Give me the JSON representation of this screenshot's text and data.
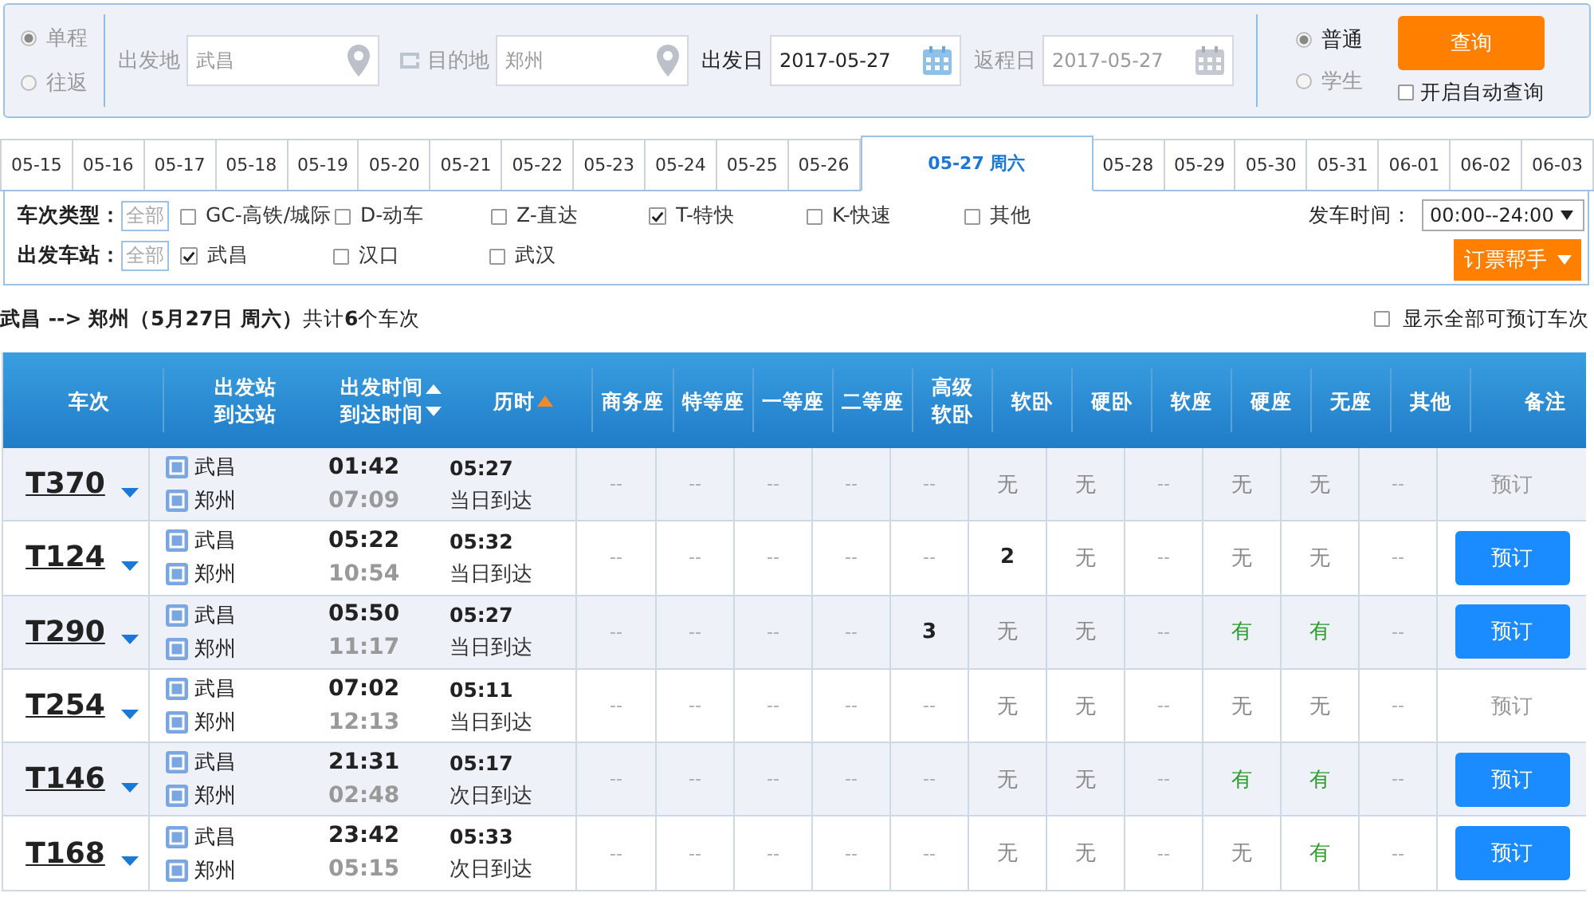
{
  "search": {
    "trip_types": [
      {
        "label": "单程",
        "selected": true
      },
      {
        "label": "往返",
        "selected": false
      }
    ],
    "fields": [
      {
        "label": "出发地",
        "value": "武昌",
        "kind": "place",
        "active": false
      },
      {
        "label": "目的地",
        "value": "郑州",
        "kind": "place",
        "active": false
      },
      {
        "label": "出发日",
        "value": "2017-05-27",
        "kind": "date",
        "active": true
      },
      {
        "label": "返程日",
        "value": "2017-05-27",
        "kind": "date",
        "active": false
      }
    ],
    "passenger_types": [
      {
        "label": "普通",
        "selected": true
      },
      {
        "label": "学生",
        "selected": false
      }
    ],
    "query_button": "查询",
    "auto_query": {
      "label": "开启自动查询",
      "checked": false
    }
  },
  "date_tabs": [
    {
      "label": "05-15",
      "selected": false
    },
    {
      "label": "05-16",
      "selected": false
    },
    {
      "label": "05-17",
      "selected": false
    },
    {
      "label": "05-18",
      "selected": false
    },
    {
      "label": "05-19",
      "selected": false
    },
    {
      "label": "05-20",
      "selected": false
    },
    {
      "label": "05-21",
      "selected": false
    },
    {
      "label": "05-22",
      "selected": false
    },
    {
      "label": "05-23",
      "selected": false
    },
    {
      "label": "05-24",
      "selected": false
    },
    {
      "label": "05-25",
      "selected": false
    },
    {
      "label": "05-26",
      "selected": false
    },
    {
      "label": "05-27 周六",
      "selected": true
    },
    {
      "label": "05-28",
      "selected": false
    },
    {
      "label": "05-29",
      "selected": false
    },
    {
      "label": "05-30",
      "selected": false
    },
    {
      "label": "05-31",
      "selected": false
    },
    {
      "label": "06-01",
      "selected": false
    },
    {
      "label": "06-02",
      "selected": false
    },
    {
      "label": "06-03",
      "selected": false
    }
  ],
  "filters": [
    {
      "label": "车次类型：",
      "all_button": "全部",
      "options": [
        {
          "label": "GC-高铁/城际",
          "checked": false
        },
        {
          "label": "D-动车",
          "checked": false
        },
        {
          "label": "Z-直达",
          "checked": false
        },
        {
          "label": "T-特快",
          "checked": true
        },
        {
          "label": "K-快速",
          "checked": false
        },
        {
          "label": "其他",
          "checked": false
        }
      ]
    },
    {
      "label": "出发车站：",
      "all_button": "全部",
      "options": [
        {
          "label": "武昌",
          "checked": true
        },
        {
          "label": "汉口",
          "checked": false
        },
        {
          "label": "武汉",
          "checked": false
        }
      ]
    }
  ],
  "departure_time": {
    "label": "发车时间：",
    "value": "00:00--24:00"
  },
  "helper_button": "订票帮手",
  "summary": "**武昌 --> 郑州（5月27日  周六）**共计**6**个车次",
  "show_all": {
    "label": "显示全部可预订车次",
    "checked": false
  },
  "table": {
    "columns": [
      "车次",
      "出发站到达站",
      "出发时间到达时间",
      "历时",
      "商务座",
      "特等座",
      "一等座",
      "二等座",
      "高级软卧",
      "软卧",
      "硬卧",
      "软座",
      "硬座",
      "无座",
      "其他",
      "备注"
    ],
    "rows": [
      {
        "train": "T370",
        "from": "武昌",
        "to": "郑州",
        "depart": "01:42",
        "arrive": "07:09",
        "duration": "05:27",
        "arrival_day": "当日到达",
        "seats": [
          {
            "text": "--",
            "kind": "na"
          },
          {
            "text": "--",
            "kind": "na"
          },
          {
            "text": "--",
            "kind": "na"
          },
          {
            "text": "--",
            "kind": "na"
          },
          {
            "text": "--",
            "kind": "na"
          },
          {
            "text": "无",
            "kind": "none"
          },
          {
            "text": "无",
            "kind": "none"
          },
          {
            "text": "--",
            "kind": "na"
          },
          {
            "text": "无",
            "kind": "none"
          },
          {
            "text": "无",
            "kind": "none"
          },
          {
            "text": "--",
            "kind": "na"
          }
        ],
        "book": {
          "label": "预订",
          "enabled": false
        }
      },
      {
        "train": "T124",
        "from": "武昌",
        "to": "郑州",
        "depart": "05:22",
        "arrive": "10:54",
        "duration": "05:32",
        "arrival_day": "当日到达",
        "seats": [
          {
            "text": "--",
            "kind": "na"
          },
          {
            "text": "--",
            "kind": "na"
          },
          {
            "text": "--",
            "kind": "na"
          },
          {
            "text": "--",
            "kind": "na"
          },
          {
            "text": "--",
            "kind": "na"
          },
          {
            "text": "2",
            "kind": "count"
          },
          {
            "text": "无",
            "kind": "none"
          },
          {
            "text": "--",
            "kind": "na"
          },
          {
            "text": "无",
            "kind": "none"
          },
          {
            "text": "无",
            "kind": "none"
          },
          {
            "text": "--",
            "kind": "na"
          }
        ],
        "book": {
          "label": "预订",
          "enabled": true
        }
      },
      {
        "train": "T290",
        "from": "武昌",
        "to": "郑州",
        "depart": "05:50",
        "arrive": "11:17",
        "duration": "05:27",
        "arrival_day": "当日到达",
        "seats": [
          {
            "text": "--",
            "kind": "na"
          },
          {
            "text": "--",
            "kind": "na"
          },
          {
            "text": "--",
            "kind": "na"
          },
          {
            "text": "--",
            "kind": "na"
          },
          {
            "text": "3",
            "kind": "count"
          },
          {
            "text": "无",
            "kind": "none"
          },
          {
            "text": "无",
            "kind": "none"
          },
          {
            "text": "--",
            "kind": "na"
          },
          {
            "text": "有",
            "kind": "available"
          },
          {
            "text": "有",
            "kind": "available"
          },
          {
            "text": "--",
            "kind": "na"
          }
        ],
        "book": {
          "label": "预订",
          "enabled": true
        }
      },
      {
        "train": "T254",
        "from": "武昌",
        "to": "郑州",
        "depart": "07:02",
        "arrive": "12:13",
        "duration": "05:11",
        "arrival_day": "当日到达",
        "seats": [
          {
            "text": "--",
            "kind": "na"
          },
          {
            "text": "--",
            "kind": "na"
          },
          {
            "text": "--",
            "kind": "na"
          },
          {
            "text": "--",
            "kind": "na"
          },
          {
            "text": "--",
            "kind": "na"
          },
          {
            "text": "无",
            "kind": "none"
          },
          {
            "text": "无",
            "kind": "none"
          },
          {
            "text": "--",
            "kind": "na"
          },
          {
            "text": "无",
            "kind": "none"
          },
          {
            "text": "无",
            "kind": "none"
          },
          {
            "text": "--",
            "kind": "na"
          }
        ],
        "book": {
          "label": "预订",
          "enabled": false
        }
      },
      {
        "train": "T146",
        "from": "武昌",
        "to": "郑州",
        "depart": "21:31",
        "arrive": "02:48",
        "duration": "05:17",
        "arrival_day": "次日到达",
        "seats": [
          {
            "text": "--",
            "kind": "na"
          },
          {
            "text": "--",
            "kind": "na"
          },
          {
            "text": "--",
            "kind": "na"
          },
          {
            "text": "--",
            "kind": "na"
          },
          {
            "text": "--",
            "kind": "na"
          },
          {
            "text": "无",
            "kind": "none"
          },
          {
            "text": "无",
            "kind": "none"
          },
          {
            "text": "--",
            "kind": "na"
          },
          {
            "text": "有",
            "kind": "available"
          },
          {
            "text": "有",
            "kind": "available"
          },
          {
            "text": "--",
            "kind": "na"
          }
        ],
        "book": {
          "label": "预订",
          "enabled": true
        }
      },
      {
        "train": "T168",
        "from": "武昌",
        "to": "郑州",
        "depart": "23:42",
        "arrive": "05:15",
        "duration": "05:33",
        "arrival_day": "次日到达",
        "seats": [
          {
            "text": "--",
            "kind": "na"
          },
          {
            "text": "--",
            "kind": "na"
          },
          {
            "text": "--",
            "kind": "na"
          },
          {
            "text": "--",
            "kind": "na"
          },
          {
            "text": "--",
            "kind": "na"
          },
          {
            "text": "无",
            "kind": "none"
          },
          {
            "text": "无",
            "kind": "none"
          },
          {
            "text": "--",
            "kind": "na"
          },
          {
            "text": "无",
            "kind": "none"
          },
          {
            "text": "有",
            "kind": "available"
          },
          {
            "text": "--",
            "kind": "na"
          }
        ],
        "book": {
          "label": "预订",
          "enabled": true
        }
      }
    ]
  }
}
